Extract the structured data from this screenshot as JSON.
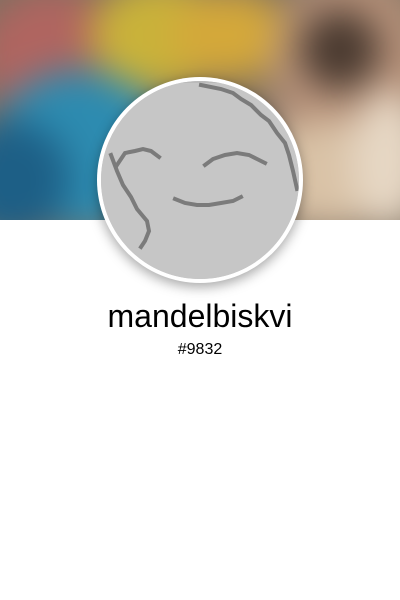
{
  "profile": {
    "username": "mandelbiskvi",
    "discriminator": "#9832"
  },
  "avatar": {
    "icon": "smiling-face-drawing",
    "background_color": "#c6c6c6",
    "line_color": "#7b7b7b"
  },
  "banner": {
    "description_colors": [
      "#c0b13a",
      "#2e8fb5",
      "#c98a62",
      "#a85a55",
      "#6b5e4b"
    ]
  }
}
